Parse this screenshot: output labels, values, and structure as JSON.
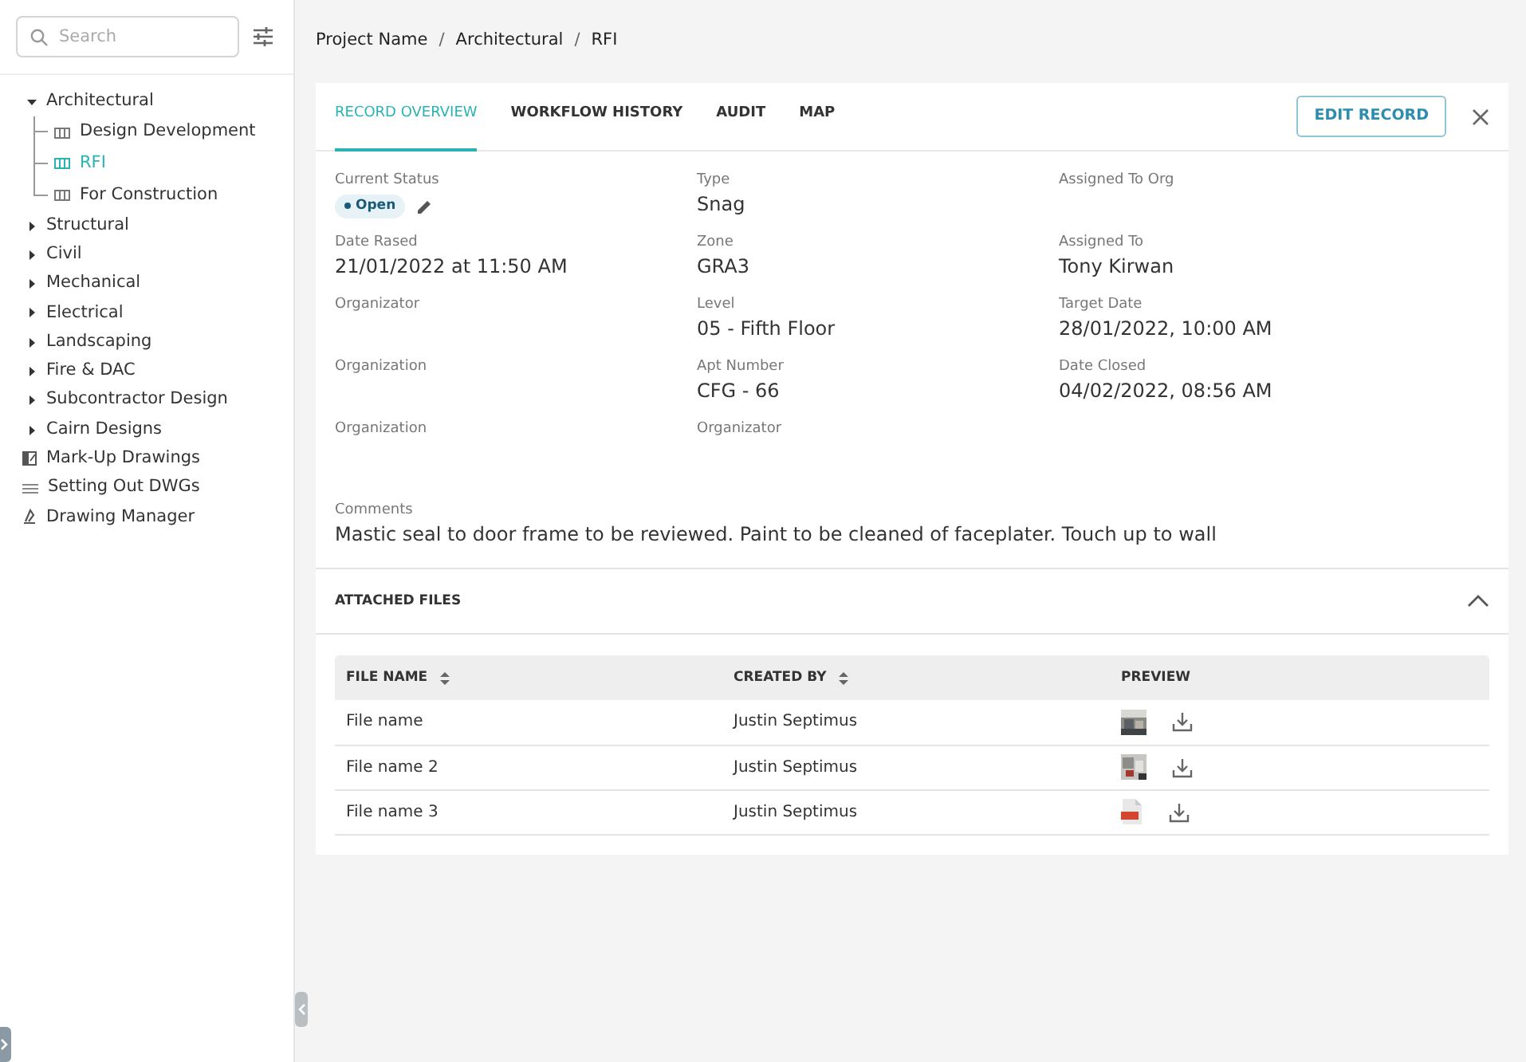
{
  "sidebar": {
    "search": {
      "placeholder": "Search"
    },
    "items": [
      {
        "label": "Architectural",
        "kind": "group",
        "expanded": true,
        "selected": false,
        "children": [
          {
            "label": "Design Development",
            "kind": "sheet",
            "selected": false
          },
          {
            "label": "RFI",
            "kind": "sheet",
            "selected": true
          },
          {
            "label": "For Construction",
            "kind": "sheet",
            "selected": false
          }
        ]
      },
      {
        "label": "Structural",
        "kind": "group",
        "expanded": false,
        "selected": false
      },
      {
        "label": "Civil",
        "kind": "group",
        "expanded": false,
        "selected": false
      },
      {
        "label": "Mechanical",
        "kind": "group",
        "expanded": false,
        "selected": false
      },
      {
        "label": "Electrical",
        "kind": "group",
        "expanded": false,
        "selected": false
      },
      {
        "label": "Landscaping",
        "kind": "group",
        "expanded": false,
        "selected": false
      },
      {
        "label": "Fire & DAC",
        "kind": "group",
        "expanded": false,
        "selected": false
      },
      {
        "label": "Subcontractor Design",
        "kind": "group",
        "expanded": false,
        "selected": false
      },
      {
        "label": "Cairn Designs",
        "kind": "group",
        "expanded": false,
        "selected": false
      },
      {
        "label": "Mark-Up Drawings",
        "kind": "markup",
        "selected": false
      },
      {
        "label": "Setting Out DWGs",
        "kind": "list",
        "selected": false
      },
      {
        "label": "Drawing Manager",
        "kind": "manager",
        "selected": false
      }
    ]
  },
  "breadcrumb": [
    {
      "label": "Project Name",
      "kind": "link"
    },
    {
      "label": "/",
      "kind": "separator"
    },
    {
      "label": "Architectural",
      "kind": "link"
    },
    {
      "label": "/",
      "kind": "separator"
    },
    {
      "label": "RFI",
      "kind": "link"
    }
  ],
  "tabs": [
    {
      "label": "RECORD OVERVIEW",
      "selected": true
    },
    {
      "label": "WORKFLOW HISTORY",
      "selected": false
    },
    {
      "label": "AUDIT",
      "selected": false
    },
    {
      "label": "MAP",
      "selected": false
    }
  ],
  "edit_button": "EDIT RECORD",
  "fields": [
    {
      "label": "Current Status",
      "kind": "status",
      "value": "Open"
    },
    {
      "label": "Type",
      "kind": "text",
      "value": "Snag"
    },
    {
      "label": "Assigned To Org",
      "kind": "text"
    },
    {
      "label": "Date Rased",
      "kind": "text",
      "value": "21/01/2022 at 11:50 AM"
    },
    {
      "label": "Zone",
      "kind": "text",
      "value": "GRA3"
    },
    {
      "label": "Assigned To",
      "kind": "text",
      "value": "Tony Kirwan"
    },
    {
      "label": "Organizator",
      "kind": "text"
    },
    {
      "label": "Level",
      "kind": "text",
      "value": "05 - Fifth Floor"
    },
    {
      "label": "Target Date",
      "kind": "text",
      "value": "28/01/2022, 10:00 AM"
    },
    {
      "label": "Organization",
      "kind": "text"
    },
    {
      "label": "Apt Number",
      "kind": "text",
      "value": "CFG - 66"
    },
    {
      "label": "Date Closed",
      "kind": "text",
      "value": "04/02/2022, 08:56  AM"
    },
    {
      "label": "Organization",
      "kind": "text"
    },
    {
      "label": "Organizator",
      "kind": "text"
    }
  ],
  "comments": {
    "label": "Comments",
    "value": "Mastic seal to door frame to be reviewed. Paint to be cleaned of faceplater. Touch up to wall"
  },
  "attached_files": {
    "title": "ATTACHED FILES",
    "expanded": true,
    "columns": [
      {
        "label": "FILE NAME",
        "sortable": true
      },
      {
        "label": "CREATED BY",
        "sortable": true
      },
      {
        "label": "PREVIEW",
        "sortable": false
      }
    ],
    "rows": [
      {
        "name": "File name",
        "created_by": "Justin Septimus"
      },
      {
        "name": "File name 2",
        "created_by": "Justin Septimus"
      },
      {
        "name": "File name 3",
        "created_by": "Justin Septimus",
        "kind": "pdf"
      }
    ]
  }
}
